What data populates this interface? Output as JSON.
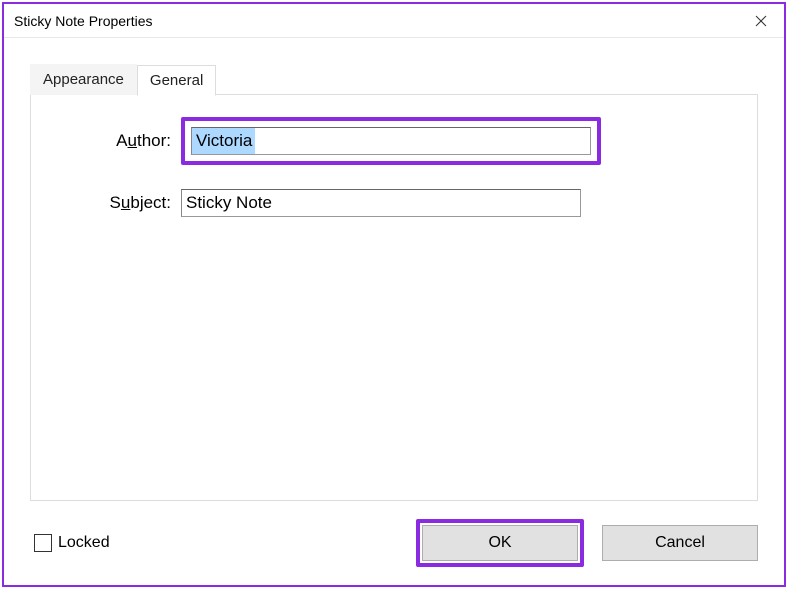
{
  "window": {
    "title": "Sticky Note Properties"
  },
  "tabs": {
    "appearance": "Appearance",
    "general": "General"
  },
  "fields": {
    "author": {
      "label_pre": "A",
      "label_accel": "u",
      "label_post": "thor:",
      "value": "Victoria"
    },
    "subject": {
      "label_pre": "S",
      "label_accel": "u",
      "label_post": "bject:",
      "value": "Sticky Note"
    }
  },
  "locked": {
    "label": "Locked",
    "checked": false
  },
  "buttons": {
    "ok": "OK",
    "cancel": "Cancel"
  }
}
